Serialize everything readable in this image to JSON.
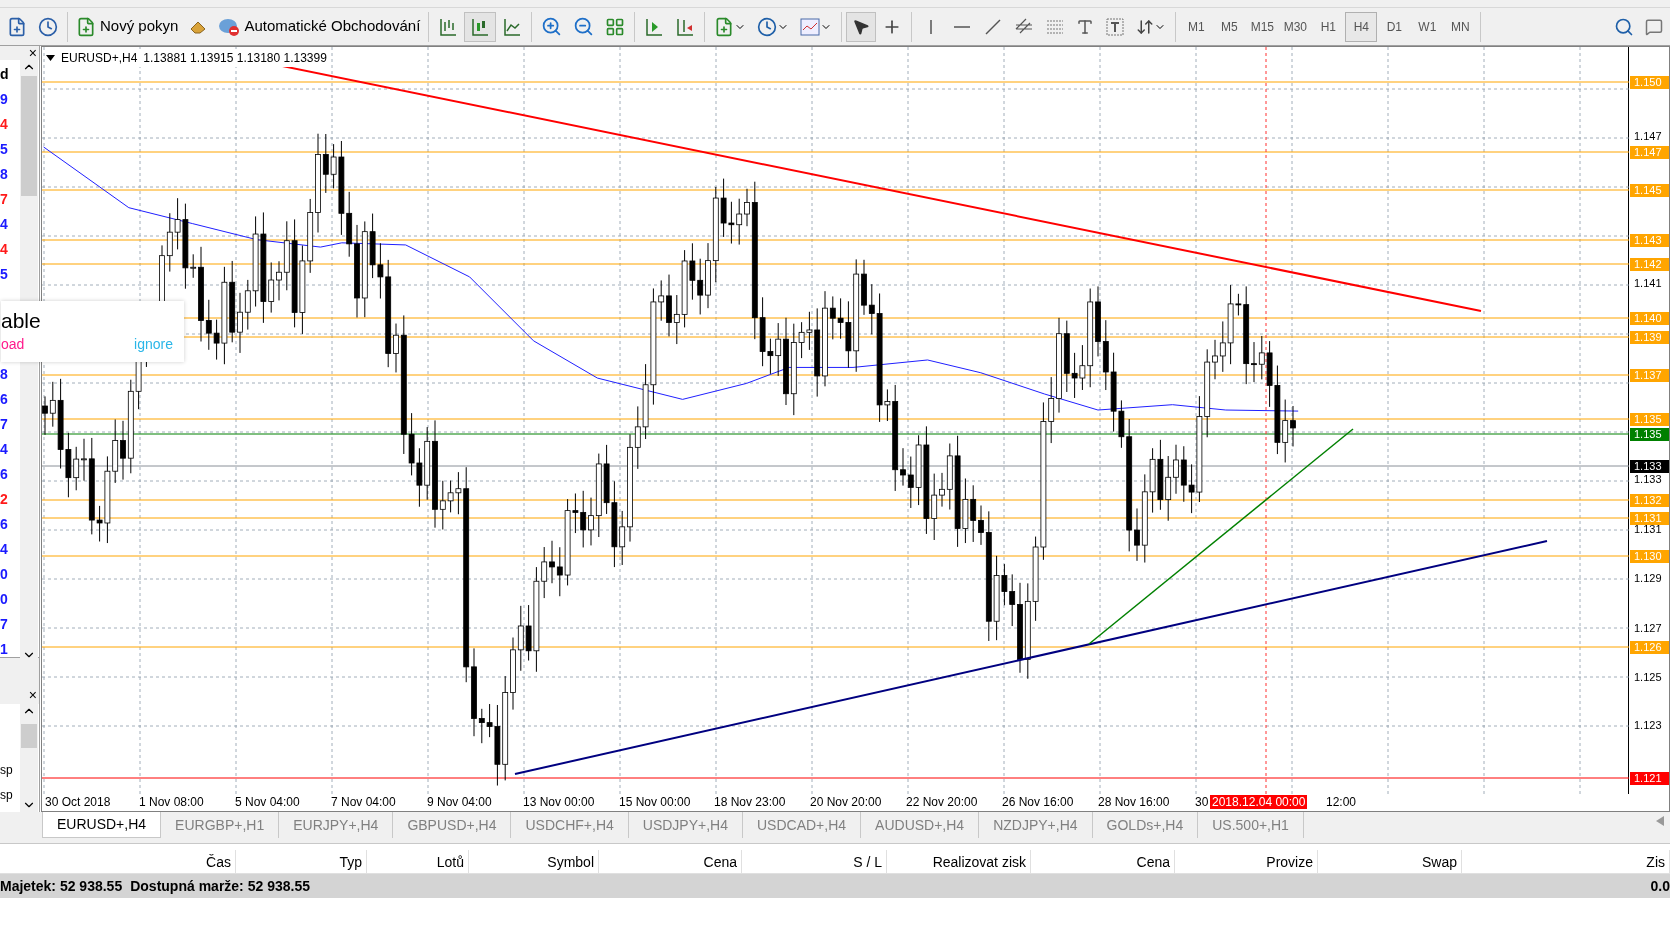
{
  "toolbar": {
    "order_button": "Nový pokyn",
    "auto_trading_button": "Automatické Obchodování",
    "timeframes": [
      {
        "label": "M1",
        "selected": false
      },
      {
        "label": "M5",
        "selected": false
      },
      {
        "label": "M15",
        "selected": false
      },
      {
        "label": "M30",
        "selected": false
      },
      {
        "label": "H1",
        "selected": false
      },
      {
        "label": "H4",
        "selected": true
      },
      {
        "label": "D1",
        "selected": false
      },
      {
        "label": "W1",
        "selected": false
      },
      {
        "label": "MN",
        "selected": false
      }
    ]
  },
  "market_watch": {
    "close": "×",
    "rows": [
      {
        "text": "d",
        "color": "#000000"
      },
      {
        "text": "9",
        "color": "#1a1aff"
      },
      {
        "text": "4",
        "color": "#ff1a1a"
      },
      {
        "text": "5",
        "color": "#1a1aff"
      },
      {
        "text": "8",
        "color": "#1a1aff"
      },
      {
        "text": "7",
        "color": "#ff1a1a"
      },
      {
        "text": "4",
        "color": "#1a1aff"
      },
      {
        "text": "4",
        "color": "#ff1a1a"
      },
      {
        "text": "5",
        "color": "#1a1aff"
      },
      {
        "text": "8",
        "color": "#1a1aff"
      },
      {
        "text": "6",
        "color": "#1a1aff"
      },
      {
        "text": "7",
        "color": "#1a1aff"
      },
      {
        "text": "4",
        "color": "#1a1aff"
      },
      {
        "text": "6",
        "color": "#1a1aff"
      },
      {
        "text": "2",
        "color": "#ff1a1a"
      },
      {
        "text": "6",
        "color": "#1a1aff"
      },
      {
        "text": "4",
        "color": "#1a1aff"
      },
      {
        "text": "0",
        "color": "#1a1aff"
      },
      {
        "text": "0",
        "color": "#1a1aff"
      },
      {
        "text": "7",
        "color": "#1a1aff"
      },
      {
        "text": "1",
        "color": "#1a1aff"
      }
    ]
  },
  "navigator": {
    "close": "×",
    "rows": [
      "sp",
      "sp"
    ]
  },
  "notification": {
    "title": "able",
    "action": "oad",
    "dismiss": "ignore"
  },
  "chart": {
    "symbol": "EURUSD+,H4",
    "ohlc": "1.13881 1.13915 1.13180 1.13399",
    "price_tags": [
      {
        "text": "1.150",
        "kind": "level"
      },
      {
        "text": "1.147",
        "kind": "level"
      },
      {
        "text": "1.145",
        "kind": "level"
      },
      {
        "text": "1.143",
        "kind": "level"
      },
      {
        "text": "1.142",
        "kind": "level"
      },
      {
        "text": "1.140",
        "kind": "level"
      },
      {
        "text": "1.139",
        "kind": "level"
      },
      {
        "text": "1.137",
        "kind": "level"
      },
      {
        "text": "1.135",
        "kind": "level"
      },
      {
        "text": "1.135",
        "kind": "trend"
      },
      {
        "text": "1.133",
        "kind": "bid"
      },
      {
        "text": "1.132",
        "kind": "level"
      },
      {
        "text": "1.131",
        "kind": "level"
      },
      {
        "text": "1.130",
        "kind": "level"
      },
      {
        "text": "1.126",
        "kind": "level"
      },
      {
        "text": "1.121",
        "kind": "stop"
      }
    ],
    "price_scale": [
      "1.147",
      "1.141",
      "1.133",
      "1.131",
      "1.129",
      "1.127",
      "1.125",
      "1.123"
    ],
    "time_labels": [
      {
        "text": "30 Oct 2018",
        "kind": "date"
      },
      {
        "text": "1 Nov 08:00",
        "kind": "date"
      },
      {
        "text": "5 Nov 04:00",
        "kind": "date"
      },
      {
        "text": "7 Nov 04:00",
        "kind": "date"
      },
      {
        "text": "9 Nov 04:00",
        "kind": "date"
      },
      {
        "text": "13 Nov 00:00",
        "kind": "date"
      },
      {
        "text": "15 Nov 00:00",
        "kind": "date"
      },
      {
        "text": "18 Nov 23:00",
        "kind": "date"
      },
      {
        "text": "20 Nov 20:00",
        "kind": "date"
      },
      {
        "text": "22 Nov 20:00",
        "kind": "date"
      },
      {
        "text": "26 Nov 16:00",
        "kind": "date"
      },
      {
        "text": "28 Nov 16:00",
        "kind": "date"
      },
      {
        "text": "30",
        "kind": "date"
      },
      {
        "text": "2018.12.04 00:00",
        "kind": "cursor"
      },
      {
        "text": "12:00",
        "kind": "date"
      }
    ]
  },
  "chart_tabs": [
    {
      "label": "EURUSD+,H4",
      "selected": true
    },
    {
      "label": "EURGBP+,H1",
      "selected": false
    },
    {
      "label": "EURJPY+,H4",
      "selected": false
    },
    {
      "label": "GBPUSD+,H4",
      "selected": false
    },
    {
      "label": "USDCHF+,H4",
      "selected": false
    },
    {
      "label": "USDJPY+,H4",
      "selected": false
    },
    {
      "label": "USDCAD+,H4",
      "selected": false
    },
    {
      "label": "AUDUSD+,H4",
      "selected": false
    },
    {
      "label": "NZDJPY+,H4",
      "selected": false
    },
    {
      "label": "GOLDs+,H4",
      "selected": false
    },
    {
      "label": "US.500+,H1",
      "selected": false
    }
  ],
  "terminal": {
    "columns": [
      "Čas",
      "Typ",
      "Lotů",
      "Symbol",
      "Cena",
      "S / L",
      "Realizovat zisk",
      "Cena",
      "Provize",
      "Swap",
      "Zis"
    ],
    "balance": "Majetek: 52 938.55",
    "margin": "Dostupná marže: 52 938.55",
    "total": "0.0"
  }
}
